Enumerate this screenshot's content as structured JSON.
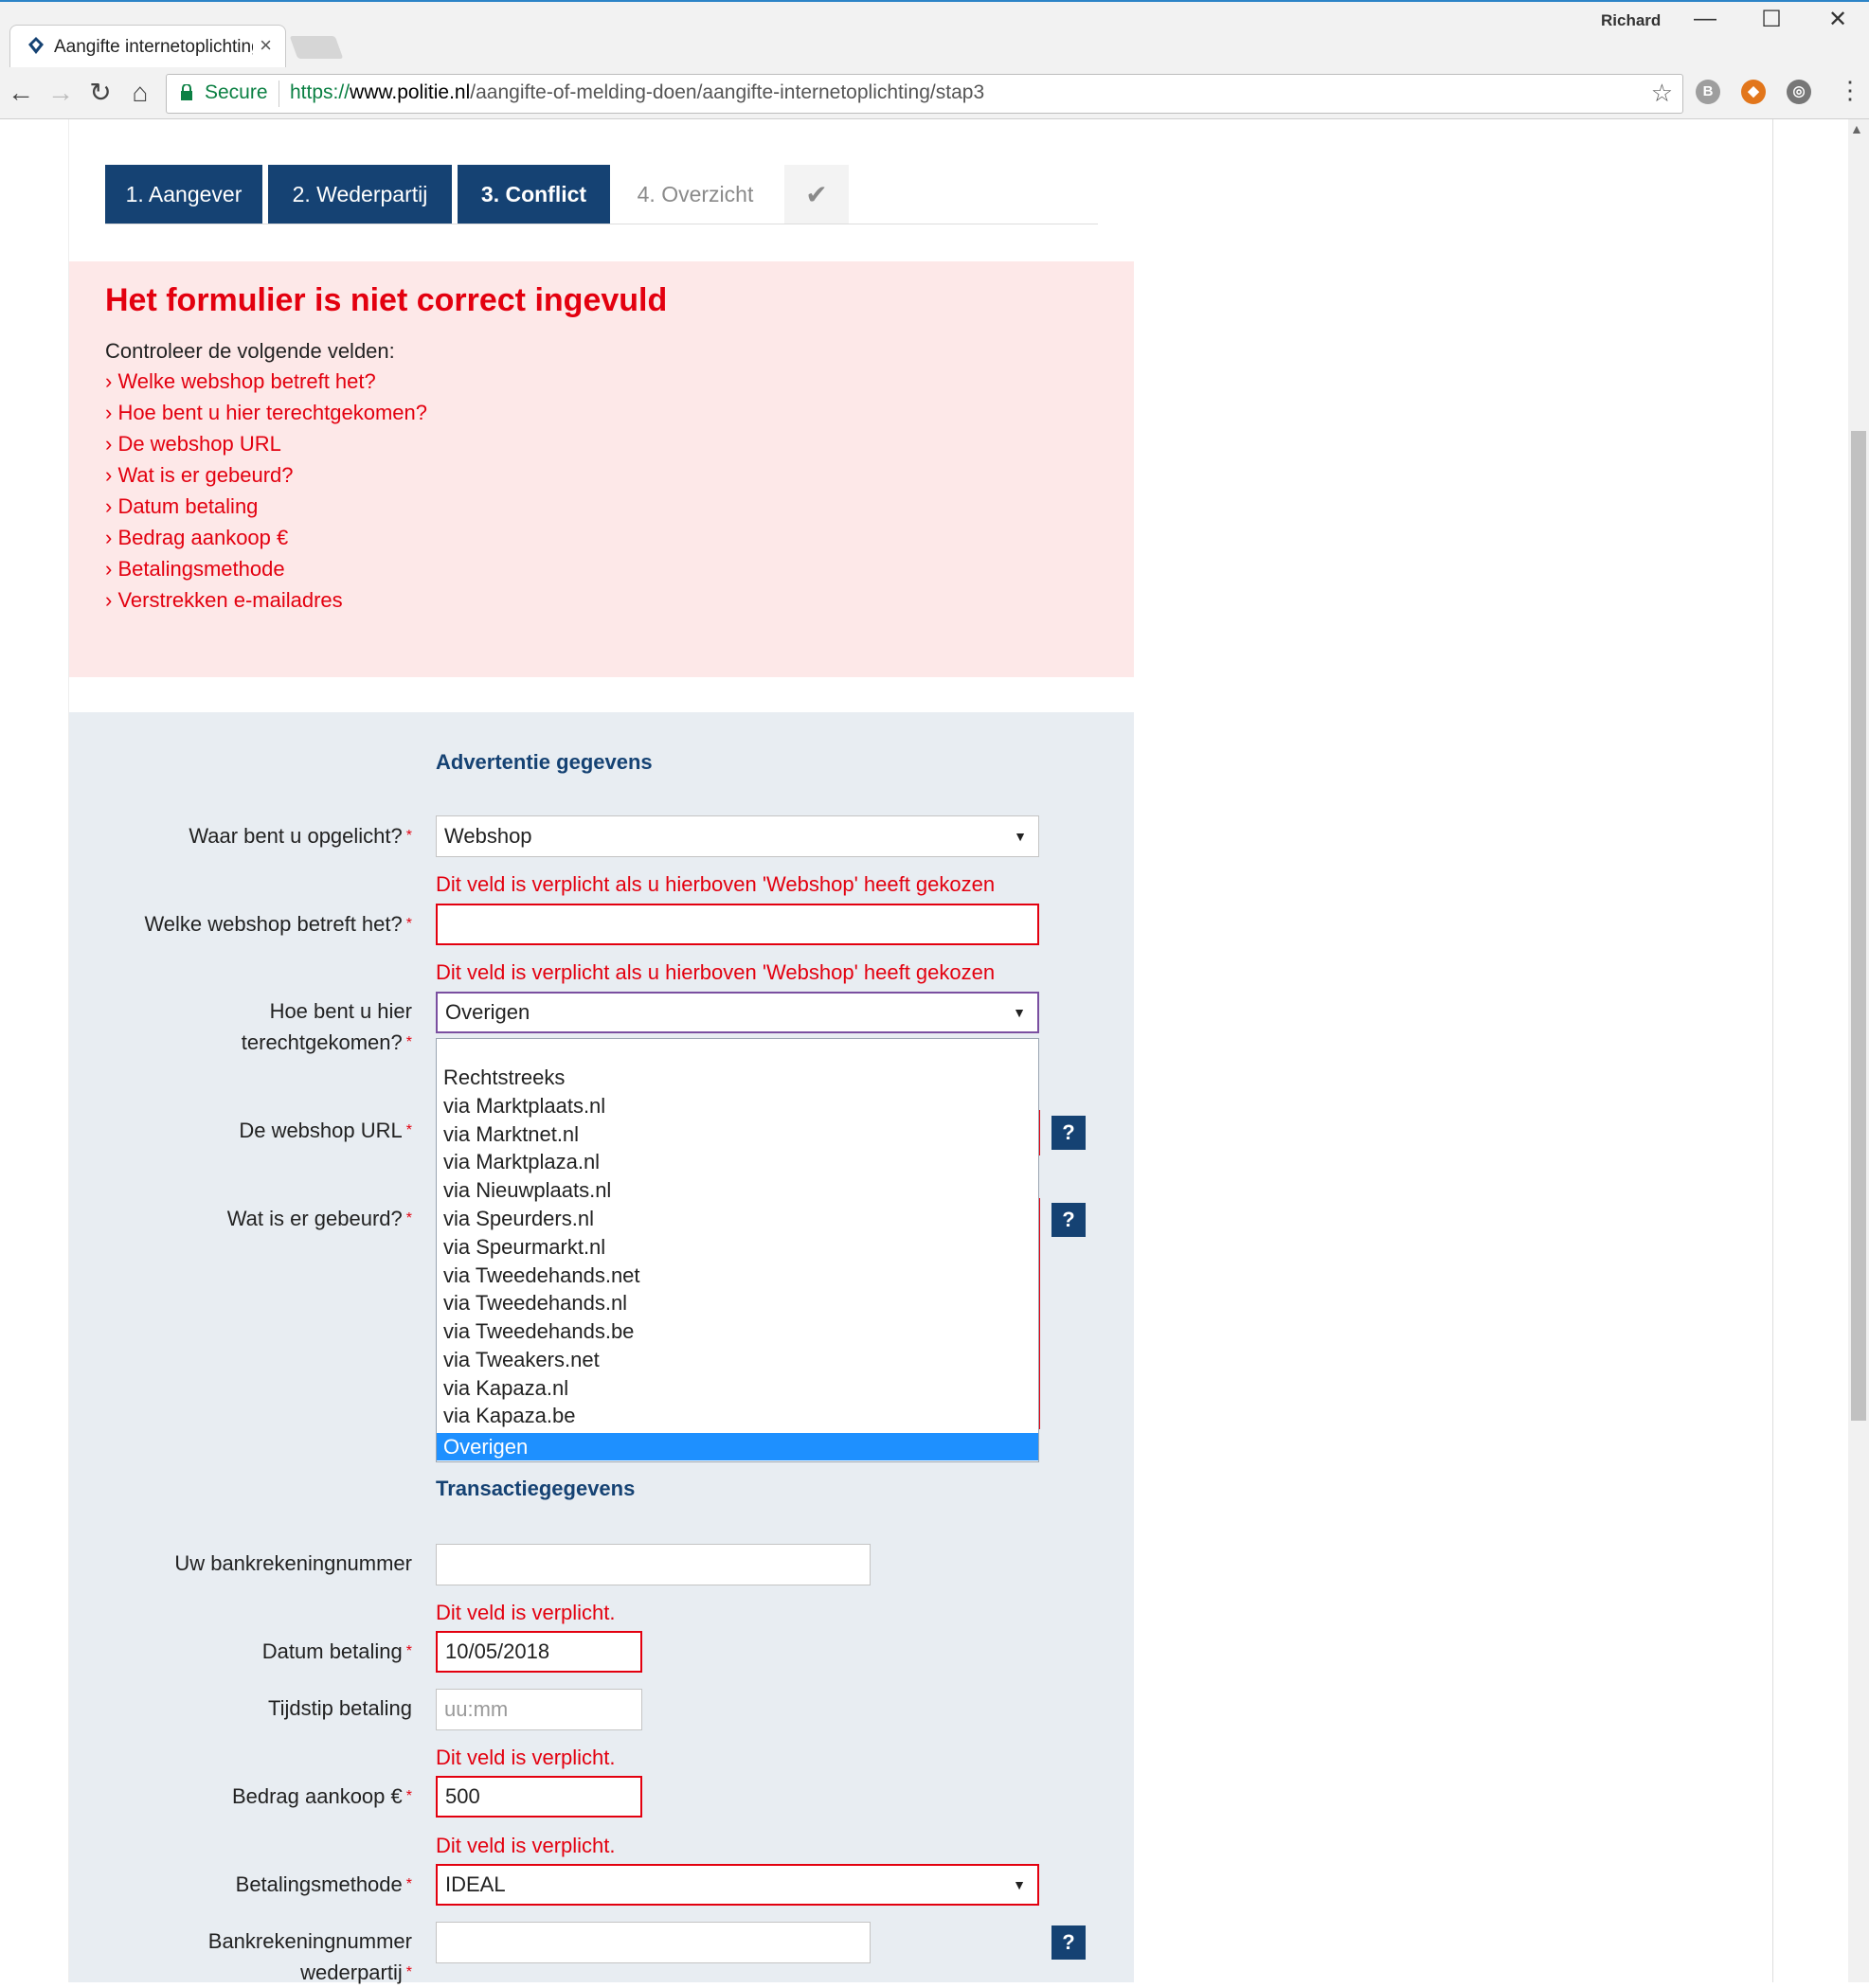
{
  "browser": {
    "tab_title": "Aangifte internetoplichting",
    "tab_close": "×",
    "user": "Richard",
    "secure": "Secure",
    "url_scheme": "https://",
    "url_host": "www.politie.nl",
    "url_path": "/aangifte-of-melding-doen/aangifte-internetoplichting/stap3",
    "window_controls": {
      "minimize": "—",
      "maximize": "☐",
      "close": "✕"
    },
    "nav": {
      "back": "←",
      "forward": "→",
      "reload": "↻",
      "home": "⌂"
    }
  },
  "steps": [
    {
      "label": "1. Aangever",
      "state": "done"
    },
    {
      "label": "2. Wederpartij",
      "state": "done"
    },
    {
      "label": "3. Conflict",
      "state": "current"
    },
    {
      "label": "4. Overzicht",
      "state": "todo"
    },
    {
      "label": "✔",
      "state": "todo"
    }
  ],
  "error_summary": {
    "title": "Het formulier is niet correct ingevuld",
    "intro": "Controleer de volgende velden:",
    "links": [
      "› Welke webshop betreft het?",
      "› Hoe bent u hier terechtgekomen?",
      "› De webshop URL",
      "› Wat is er gebeurd?",
      "› Datum betaling",
      "› Bedrag aankoop €",
      "› Betalingsmethode",
      "› Verstrekken e-mailadres"
    ]
  },
  "form": {
    "section_ad": "Advertentie gegevens",
    "section_tx": "Transactiegegevens",
    "waar_label": "Waar bent u opgelicht?",
    "waar_value": "Webshop",
    "webshop_error": "Dit veld is verplicht als u hierboven 'Webshop' heeft gekozen",
    "webshop_label": "Welke webshop betreft het?",
    "hoe_error": "Dit veld is verplicht als u hierboven 'Webshop' heeft gekozen",
    "hoe_label_1": "Hoe bent u hier",
    "hoe_label_2": "terechtgekomen?",
    "hoe_value": "Overigen",
    "url_label": "De webshop URL",
    "gebeurd_label": "Wat is er gebeurd?",
    "help": "?",
    "required_mark": "*",
    "dropdown_options": [
      "",
      "Rechtstreeks",
      "via Marktplaats.nl",
      "via Marktnet.nl",
      "via Marktplaza.nl",
      "via Nieuwplaats.nl",
      "via Speurders.nl",
      "via Speurmarkt.nl",
      "via Tweedehands.net",
      "via Tweedehands.nl",
      "via Tweedehands.be",
      "via Tweakers.net",
      "via Kapaza.nl",
      "via Kapaza.be",
      "Overigen"
    ],
    "dropdown_selected": "Overigen",
    "bank_label": "Uw bankrekeningnummer",
    "datum_error": "Dit veld is verplicht.",
    "datum_label": "Datum betaling",
    "datum_value": "10/05/2018",
    "tijd_label": "Tijdstip betaling",
    "tijd_placeholder": "uu:mm",
    "bedrag_error": "Dit veld is verplicht.",
    "bedrag_label": "Bedrag aankoop €",
    "bedrag_value": "500",
    "methode_error": "Dit veld is verplicht.",
    "methode_label": "Betalingsmethode",
    "methode_value": "IDEAL",
    "wederpartij_label_1": "Bankrekeningnummer",
    "wederpartij_label_2": "wederpartij"
  },
  "colors": {
    "brand": "#154273",
    "error": "#e3000f",
    "error_bg": "#fde8e8",
    "panel_bg": "#e8edf2",
    "highlight": "#1e90ff"
  }
}
